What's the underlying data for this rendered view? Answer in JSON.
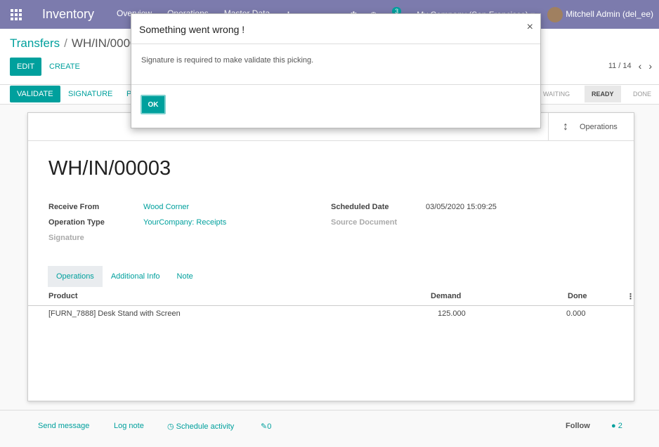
{
  "navbar": {
    "app_name": "Inventory",
    "menu": [
      "Overview",
      "Operations",
      "Master Data"
    ],
    "plus_icon": "+",
    "bug_icon": "✱",
    "clock_icon": "◷",
    "chat_icon": "●",
    "chat_count": "3",
    "company": "My Company (San Francisco)",
    "user": "Mitchell Admin (del_ee)"
  },
  "breadcrumb": {
    "root": "Transfers",
    "separator": "/",
    "current": "WH/IN/0000"
  },
  "actions": {
    "edit": "EDIT",
    "create": "CREATE"
  },
  "pager": {
    "value": "11 / 14",
    "prev": "‹",
    "next": "›"
  },
  "statusbar": {
    "validate": "VALIDATE",
    "signature": "SIGNATURE",
    "p": "P",
    "stages": [
      "WAITING",
      "READY",
      "DONE"
    ],
    "active_stage": "READY"
  },
  "stat_buttons": {
    "operations": "Operations",
    "operations_icon": "↕"
  },
  "form": {
    "name": "WH/IN/00003",
    "receive_from_label": "Receive From",
    "receive_from": "Wood Corner",
    "operation_type_label": "Operation Type",
    "operation_type": "YourCompany: Receipts",
    "signature_label": "Signature",
    "scheduled_date_label": "Scheduled Date",
    "scheduled_date": "03/05/2020 15:09:25",
    "source_document_label": "Source Document"
  },
  "tabs": [
    "Operations",
    "Additional Info",
    "Note"
  ],
  "table": {
    "headers": {
      "product": "Product",
      "demand": "Demand",
      "done": "Done"
    },
    "rows": [
      {
        "product": "[FURN_7888] Desk Stand with Screen",
        "demand": "125.000",
        "done": "0.000"
      }
    ],
    "options_icon": "⋮"
  },
  "chatter": {
    "send_message": "Send message",
    "log_note": "Log note",
    "schedule_activity": "Schedule activity",
    "attachments": "0",
    "follow": "Follow",
    "followers": "2"
  },
  "modal": {
    "title": "Something went wrong !",
    "close": "×",
    "message": "Signature is required to make validate this picking.",
    "ok": "OK"
  }
}
